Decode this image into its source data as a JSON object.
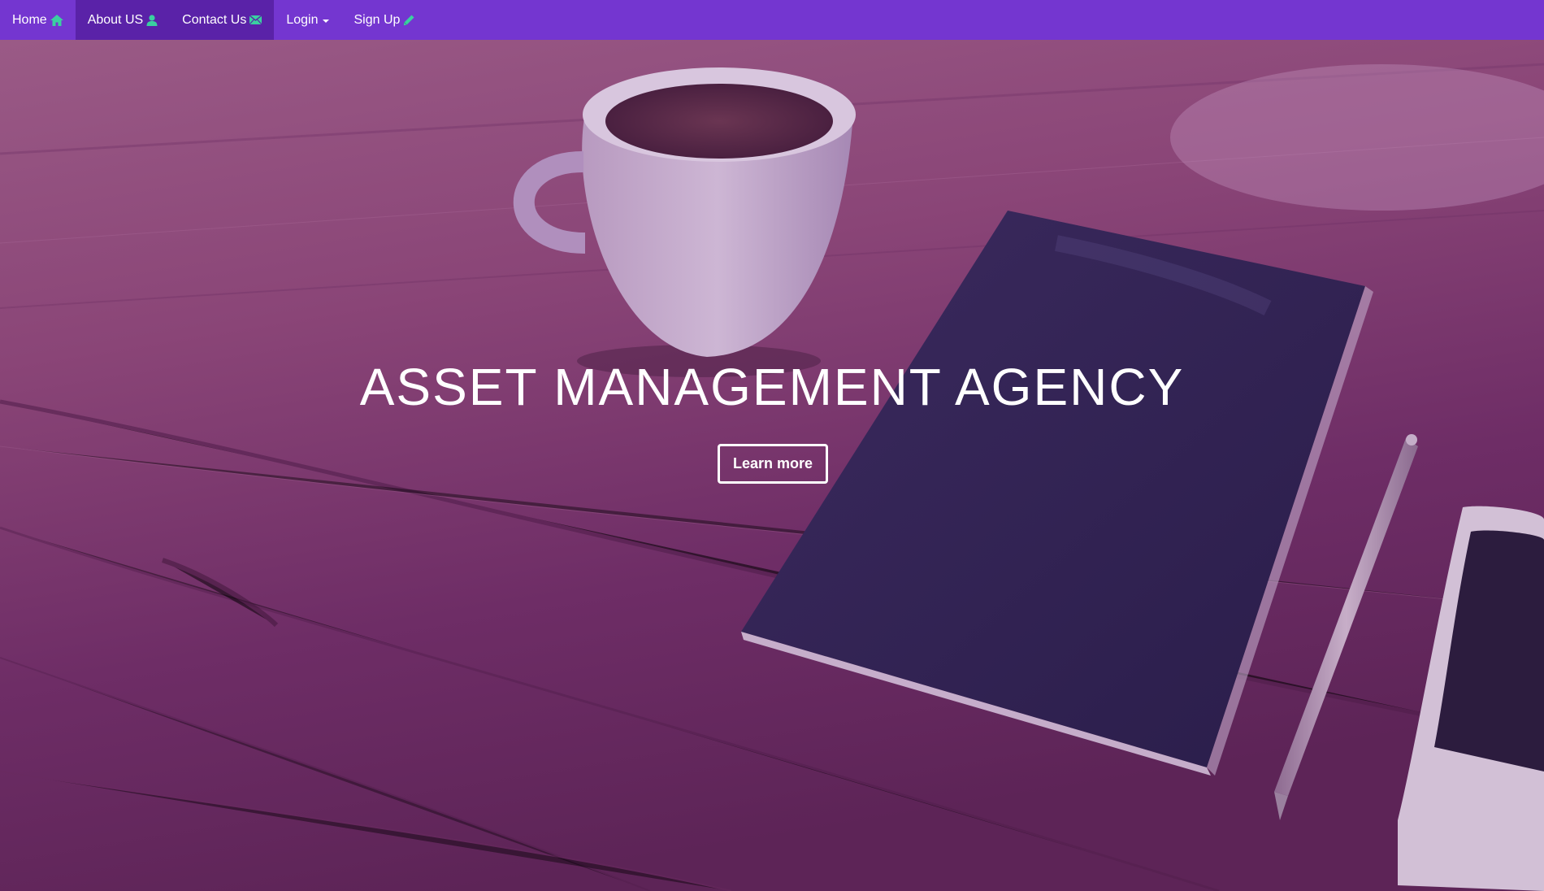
{
  "navbar": {
    "items": [
      {
        "label": "Home",
        "icon": "home-icon"
      },
      {
        "label": "About US",
        "icon": "user-icon"
      },
      {
        "label": "Contact Us",
        "icon": "envelope-icon"
      },
      {
        "label": "Login",
        "icon": "caret-down-icon"
      },
      {
        "label": "Sign Up",
        "icon": "pencil-icon"
      }
    ]
  },
  "hero": {
    "title": "ASSET MANAGEMENT AGENCY",
    "button_label": "Learn more"
  },
  "colors": {
    "navbar_bg": "#7436d0",
    "navbar_active_bg": "#5a22a8",
    "icon_accent": "#3ad0a0",
    "hero_overlay": "#7a3a78"
  }
}
